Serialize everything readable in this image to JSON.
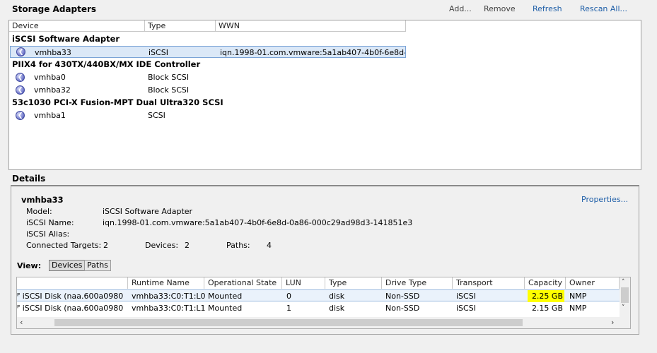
{
  "storage_adapters": {
    "title": "Storage Adapters",
    "actions": {
      "add": "Add...",
      "remove": "Remove",
      "refresh": "Refresh",
      "rescan": "Rescan All..."
    },
    "columns": [
      "Device",
      "Type",
      "WWN"
    ],
    "groups": [
      {
        "name": "iSCSI Software Adapter",
        "items": [
          {
            "device": "vmhba33",
            "type": "iSCSI",
            "wwn": "iqn.1998-01.com.vmware:5a1ab407-4b0f-6e8d-0a..."
          }
        ]
      },
      {
        "name": "PIIX4 for 430TX/440BX/MX IDE Controller",
        "items": [
          {
            "device": "vmhba0",
            "type": "Block SCSI",
            "wwn": ""
          },
          {
            "device": "vmhba32",
            "type": "Block SCSI",
            "wwn": ""
          }
        ]
      },
      {
        "name": "53c1030 PCI-X Fusion-MPT Dual Ultra320 SCSI",
        "items": [
          {
            "device": "vmhba1",
            "type": "SCSI",
            "wwn": ""
          }
        ]
      }
    ]
  },
  "details": {
    "title": "Details",
    "adapter_name": "vmhba33",
    "properties_link": "Properties...",
    "model_label": "Model:",
    "model_value": "iSCSI Software Adapter",
    "iscsi_name_label": "iSCSI Name:",
    "iscsi_name_value": "iqn.1998-01.com.vmware:5a1ab407-4b0f-6e8d-0a86-000c29ad98d3-141851e3",
    "iscsi_alias_label": "iSCSI Alias:",
    "connected_targets_label": "Connected Targets:",
    "connected_targets_value": "2",
    "devices_label": "Devices:",
    "devices_value": "2",
    "paths_label": "Paths:",
    "paths_value": "4",
    "view_label": "View:",
    "view_buttons": {
      "devices": "Devices",
      "paths": "Paths"
    },
    "table": {
      "columns": [
        "",
        "Runtime Name",
        "Operational State",
        "LUN",
        "Type",
        "Drive Type",
        "Transport",
        "Capacity",
        "Owner"
      ],
      "rows": [
        {
          "name": "iSCSI Disk (naa.600a0980...",
          "runtime": "vmhba33:C0:T1:L0",
          "state": "Mounted",
          "lun": "0",
          "type": "disk",
          "drive_type": "Non-SSD",
          "transport": "iSCSI",
          "capacity": "2.25 GB",
          "owner": "NMP"
        },
        {
          "name": "iSCSI Disk (naa.600a0980...",
          "runtime": "vmhba33:C0:T1:L1",
          "state": "Mounted",
          "lun": "1",
          "type": "disk",
          "drive_type": "Non-SSD",
          "transport": "iSCSI",
          "capacity": "2.15 GB",
          "owner": "NMP"
        }
      ],
      "highlight_color": "#ffff00"
    }
  }
}
